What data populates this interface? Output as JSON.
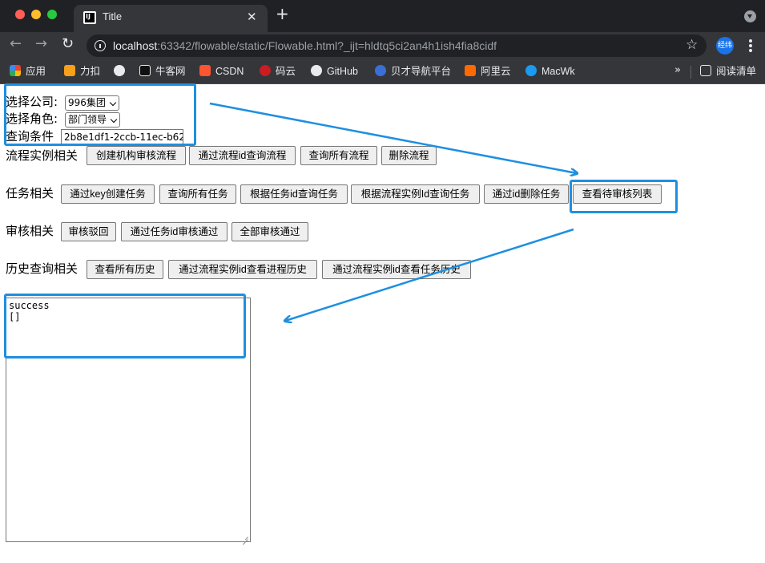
{
  "browser": {
    "tab_title": "Title",
    "tab_favicon_text": "IJ",
    "url_host": "localhost",
    "url_rest": ":63342/flowable/static/Flowable.html?_ijt=hldtq5ci2an4h1ish4fia8cidf",
    "profile_label": "经纬",
    "bookmarks": [
      {
        "label": "应用",
        "icon": "apps-grid-icon",
        "color": "#ea4335"
      },
      {
        "label": "力扣",
        "icon": "leetcode-icon",
        "color": "#f89f1b"
      },
      {
        "label": "",
        "icon": "globe-icon",
        "color": "#e8eaed"
      },
      {
        "label": "牛客网",
        "icon": "nowcoder-icon",
        "color": "#111111"
      },
      {
        "label": "CSDN",
        "icon": "csdn-icon",
        "color": "#fc5531"
      },
      {
        "label": "码云",
        "icon": "gitee-icon",
        "color": "#c71d23"
      },
      {
        "label": "GitHub",
        "icon": "github-icon",
        "color": "#e8eaed"
      },
      {
        "label": "贝才导航平台",
        "icon": "beicai-icon",
        "color": "#3b6fd8"
      },
      {
        "label": "阿里云",
        "icon": "aliyun-icon",
        "color": "#ff6a00"
      },
      {
        "label": "MacWk",
        "icon": "macwk-icon",
        "color": "#1a9bf0"
      }
    ],
    "bookmarks_overflow": "»",
    "reading_list": "阅读清单"
  },
  "form": {
    "company_label": "选择公司:",
    "company_value": "996集团",
    "role_label": "选择角色:",
    "role_value": "部门领导",
    "query_label": "查询条件",
    "query_value": "2b8e1df1-2ccb-11ec-b62"
  },
  "sections": {
    "process": {
      "label": "流程实例相关",
      "buttons": [
        "创建机构审核流程",
        "通过流程id查询流程",
        "查询所有流程",
        "删除流程"
      ]
    },
    "task": {
      "label": "任务相关",
      "buttons": [
        "通过key创建任务",
        "查询所有任务",
        "根据任务id查询任务",
        "根据流程实例Id查询任务",
        "通过id删除任务",
        "查看待审核列表"
      ]
    },
    "review": {
      "label": "审核相关",
      "buttons": [
        "审核驳回",
        "通过任务id审核通过",
        "全部审核通过"
      ]
    },
    "history": {
      "label": "历史查询相关",
      "buttons": [
        "查看所有历史",
        "通过流程实例id查看进程历史",
        "通过流程实例id查看任务历史"
      ]
    }
  },
  "output": {
    "text": "success\n[]"
  },
  "colors": {
    "annotation": "#1e8fe0",
    "chrome_dark": "#202124",
    "chrome_mid": "#35363a"
  }
}
